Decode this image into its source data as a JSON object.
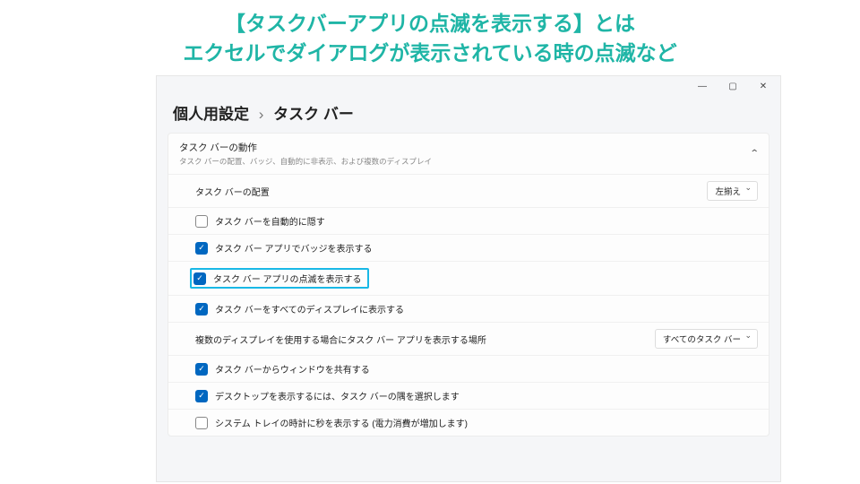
{
  "banner": {
    "line1": "【タスクバーアプリの点滅を表示する】とは",
    "line2": "エクセルでダイアログが表示されている時の点滅など"
  },
  "titlebar": {
    "min": "―",
    "max": "▢",
    "close": "✕"
  },
  "breadcrumb": {
    "a": "個人用設定",
    "sep": "›",
    "b": "タスク バー"
  },
  "panel": {
    "title": "タスク バーの動作",
    "subtitle": "タスク バーの配置、バッジ、自動的に非表示、および複数のディスプレイ"
  },
  "rows": {
    "align": {
      "label": "タスク バーの配置",
      "value": "左揃え"
    },
    "autohide": {
      "label": "タスク バーを自動的に隠す"
    },
    "badges": {
      "label": "タスク バー アプリでバッジを表示する"
    },
    "flash": {
      "label": "タスク バー アプリの点滅を表示する"
    },
    "alldisp": {
      "label": "タスク バーをすべてのディスプレイに表示する"
    },
    "multi": {
      "label": "複数のディスプレイを使用する場合にタスク バー アプリを表示する場所",
      "value": "すべてのタスク バー"
    },
    "share": {
      "label": "タスク バーからウィンドウを共有する"
    },
    "desktop": {
      "label": "デスクトップを表示するには、タスク バーの隅を選択します"
    },
    "clock": {
      "label": "システム トレイの時計に秒を表示する (電力消費が増加します)"
    }
  },
  "check": "✓"
}
